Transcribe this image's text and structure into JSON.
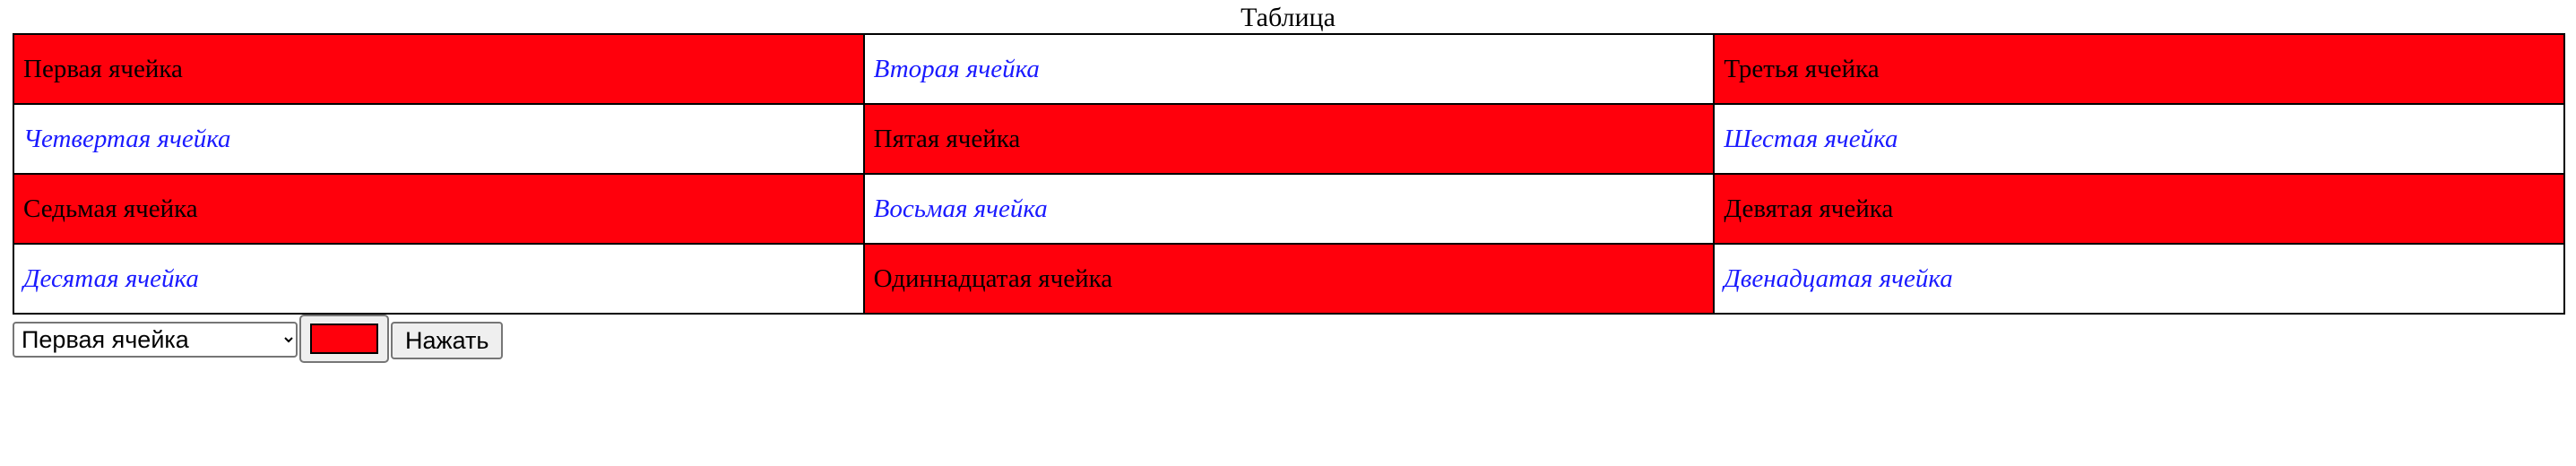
{
  "table": {
    "caption": "Таблица",
    "colors": {
      "highlight": "#ff000c",
      "plain": "#ffffff",
      "plain_text": "#1a1aff",
      "border": "#000000"
    },
    "rows": [
      [
        {
          "text": "Первая ячейка",
          "style": "red"
        },
        {
          "text": "Вторая ячейка",
          "style": "white"
        },
        {
          "text": "Третья ячейка",
          "style": "red"
        }
      ],
      [
        {
          "text": "Четвертая ячейка",
          "style": "white"
        },
        {
          "text": "Пятая ячейка",
          "style": "red"
        },
        {
          "text": "Шестая ячейка",
          "style": "white"
        }
      ],
      [
        {
          "text": "Седьмая ячейка",
          "style": "red"
        },
        {
          "text": "Восьмая ячейка",
          "style": "white"
        },
        {
          "text": "Девятая ячейка",
          "style": "red"
        }
      ],
      [
        {
          "text": "Десятая ячейка",
          "style": "white"
        },
        {
          "text": "Одиннадцатая ячейка",
          "style": "red"
        },
        {
          "text": "Двенадцатая ячейка",
          "style": "white"
        }
      ]
    ]
  },
  "controls": {
    "cell_select": {
      "selected": "Первая ячейка",
      "icon": "chevron-down-icon"
    },
    "color_picker": {
      "value": "#ff000c"
    },
    "submit_label": "Нажать"
  }
}
